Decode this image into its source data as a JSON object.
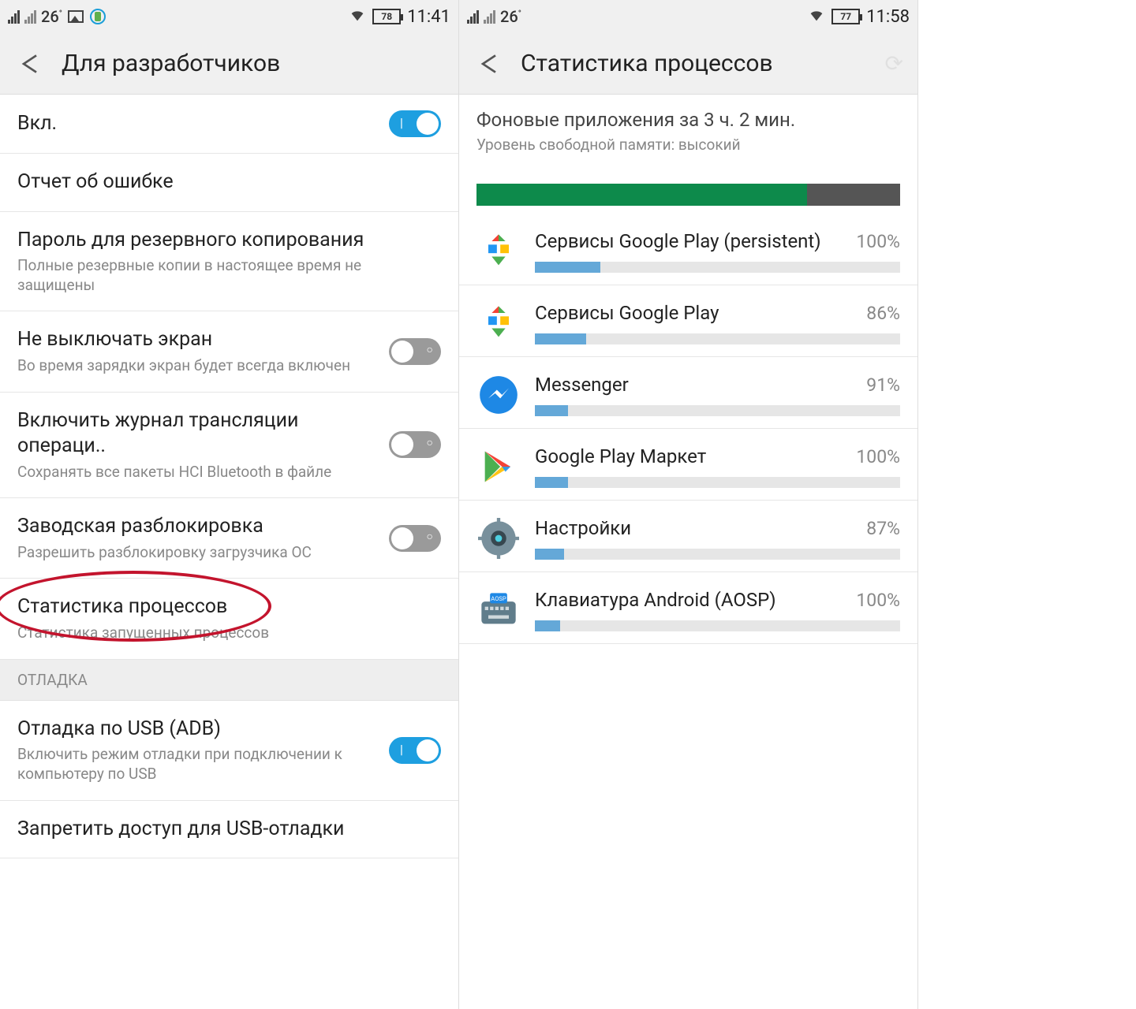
{
  "left": {
    "status": {
      "temp": "26",
      "battery": "78",
      "time": "11:41"
    },
    "appbar": {
      "title": "Для разработчиков"
    },
    "items": [
      {
        "title": "Вкл.",
        "toggle": "on"
      },
      {
        "title": "Отчет об ошибке"
      },
      {
        "title": "Пароль для резервного копирования",
        "sub": "Полные резервные копии в настоящее время не защищены"
      },
      {
        "title": "Не выключать экран",
        "sub": "Во время зарядки экран будет всегда включен",
        "toggle": "off"
      },
      {
        "title": "Включить журнал трансляции операци..",
        "sub": "Сохранять все пакеты HCI Bluetooth в файле",
        "toggle": "off"
      },
      {
        "title": "Заводская разблокировка",
        "sub": "Разрешить разблокировку загрузчика ОС",
        "toggle": "off"
      },
      {
        "title": "Статистика процессов",
        "sub": "Статистика запущенных процессов",
        "highlight": true
      }
    ],
    "section": "ОТЛАДКА",
    "items2": [
      {
        "title": "Отладка по USB (ADB)",
        "sub": "Включить режим отладки при подключении к компьютеру по USB",
        "toggle": "on"
      },
      {
        "title": "Запретить доступ для USB-отладки"
      }
    ]
  },
  "right": {
    "status": {
      "temp": "26",
      "battery": "77",
      "time": "11:58"
    },
    "appbar": {
      "title": "Статистика процессов"
    },
    "subtitle": "Фоновые приложения за 3 ч. 2 мин.",
    "subcaption": "Уровень свободной памяти: высокий",
    "memory_used_pct": 78,
    "processes": [
      {
        "name": "Сервисы Google Play (persistent)",
        "pct": 100,
        "bar": 18,
        "icon": "play-services"
      },
      {
        "name": "Сервисы Google Play",
        "pct": 86,
        "bar": 14,
        "icon": "play-services"
      },
      {
        "name": "Messenger",
        "pct": 91,
        "bar": 9,
        "icon": "messenger"
      },
      {
        "name": "Google Play Маркет",
        "pct": 100,
        "bar": 9,
        "icon": "play-store"
      },
      {
        "name": "Настройки",
        "pct": 87,
        "bar": 8,
        "icon": "settings"
      },
      {
        "name": "Клавиатура Android (AOSP)",
        "pct": 100,
        "bar": 7,
        "icon": "keyboard"
      }
    ]
  },
  "chart_data": {
    "type": "bar",
    "title": "Статистика процессов — фоновые приложения за 3 ч. 2 мин.",
    "xlabel": "",
    "ylabel": "%",
    "ylim": [
      0,
      100
    ],
    "categories": [
      "Сервисы Google Play (persistent)",
      "Сервисы Google Play",
      "Messenger",
      "Google Play Маркет",
      "Настройки",
      "Клавиатура Android (AOSP)"
    ],
    "values": [
      100,
      86,
      91,
      100,
      87,
      100
    ]
  }
}
